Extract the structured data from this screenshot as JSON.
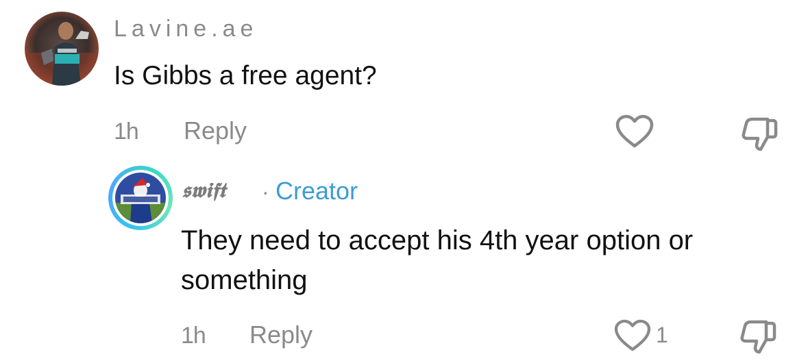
{
  "comments": [
    {
      "username": "Lavine.ae",
      "text": "Is Gibbs a free agent?",
      "time": "1h",
      "reply_label": "Reply"
    }
  ],
  "reply": {
    "username": "𝖘𝖜𝖎𝖋𝖙",
    "separator": "·",
    "badge": "Creator",
    "text": "They need to accept his 4th year option or something",
    "time": "1h",
    "reply_label": "Reply",
    "like_count": "1"
  },
  "colors": {
    "secondary_text": "#8a8a8a",
    "creator_badge": "#3c9cd3",
    "primary_text": "#111111"
  },
  "icons": {
    "like": "heart-outline-icon",
    "dislike": "thumbs-down-outline-icon"
  }
}
